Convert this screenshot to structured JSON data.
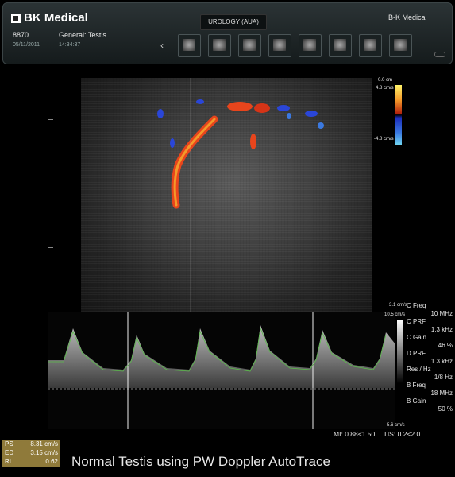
{
  "header": {
    "brand": "BK Medical",
    "patient_id": "8870",
    "date": "05/11/2011",
    "exam": "General: Testis",
    "time": "14:34:37",
    "mode": "UROLOGY (AUA)",
    "device": "B-K Medical",
    "thumbnail_count": 8
  },
  "color_scale": {
    "depth": "0.0 cm",
    "top": "4.8 cm/s",
    "bottom": "-4.8 cm/s"
  },
  "spectral_scale": {
    "top": "3.1 cm/s",
    "second": "10.5 cm/s",
    "bottom": "-5.6 cm/s"
  },
  "params": [
    {
      "label": "C Freq",
      "value": "10 MHz"
    },
    {
      "label": "C PRF",
      "value": "1.3 kHz"
    },
    {
      "label": "C Gain",
      "value": "46 %"
    },
    {
      "label": "D PRF",
      "value": "1.3 kHz"
    },
    {
      "label": "Res / Hz",
      "value": "1/8 Hz"
    },
    {
      "label": "B Freq",
      "value": "18 MHz"
    },
    {
      "label": "B Gain",
      "value": "50 %"
    }
  ],
  "indices": {
    "mi_label": "MI:",
    "mi": "0.88<1.50",
    "tis_label": "TIS:",
    "tis": "0.2<2.0"
  },
  "measurements": [
    {
      "label": "PS",
      "value": "8.31 cm/s"
    },
    {
      "label": "ED",
      "value": "3.15 cm/s"
    },
    {
      "label": "RI",
      "value": "0.62"
    }
  ],
  "caption": "Normal Testis using PW Doppler AutoTrace",
  "colors": {
    "brand_panel": "#1d2426",
    "measure_box": "#8f7a3a",
    "doppler_red": "#e8451c",
    "doppler_blue": "#2a46d8"
  }
}
